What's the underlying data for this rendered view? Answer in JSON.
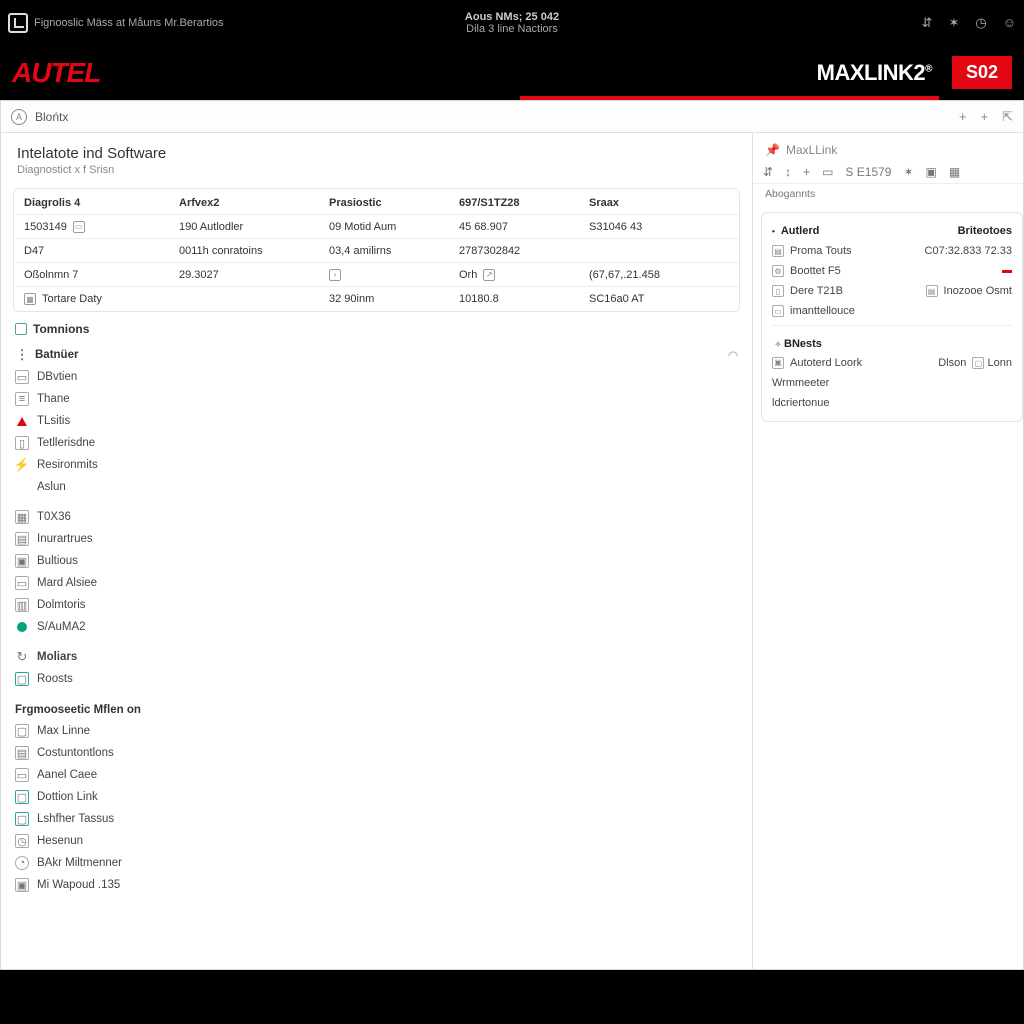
{
  "titlebar": {
    "title_left": "Fignooslic Mäss at Måuns Mr.Berartios",
    "center_line1": "Aous NMs; 25 042",
    "center_line2": "Dila 3 line Nactiors"
  },
  "brand": {
    "autel": "AUTEL",
    "maxlink": "MAXLINK2",
    "reg": "®",
    "badge": "S02"
  },
  "toolbar": {
    "breadcrumb": "Blońtx"
  },
  "page": {
    "title": "Intelatote ind Software",
    "subtitle": "Diagnostict x f Srisn"
  },
  "grid": {
    "headers": [
      "Diagrolis 4",
      "Arfvex2",
      "Prasiostic",
      "697/S1TZ28",
      "Sraax"
    ],
    "rows": [
      [
        "1503149",
        "190 Autlodler",
        "09 Motid Aum",
        "45 68.907",
        "S31046 43"
      ],
      [
        "D47",
        "0011h conratoins",
        "03,4 amilirns",
        "2787302842",
        ""
      ],
      [
        "Oßolnmn 7",
        "29.3027",
        "",
        "Orh",
        "(67,67,.21.458"
      ],
      [
        "Tortare Daty",
        "",
        "32 90inm",
        "10180.8",
        "SC16a0 AT"
      ]
    ]
  },
  "sections": {
    "tomnions": "Tomnions"
  },
  "nav_group1": {
    "head": "Batnüer",
    "items": [
      "DBvtien",
      "Thane",
      "TLsitis",
      "Tetllerisdne",
      "Resironmits",
      "Aslun"
    ]
  },
  "nav_group2": {
    "items": [
      "T0X36",
      "Inurartrues",
      "Bultious",
      "Mard Alsiee",
      "Dolmtoris",
      "S/AuMA2"
    ]
  },
  "nav_group3": {
    "items": [
      "Moliars",
      "Roosts"
    ]
  },
  "nav_group4": {
    "head": "Frgmooseetic Mflen on",
    "items": [
      "Max Linne",
      "Costuntontlons",
      "Aanel Caee",
      "Dottion Link",
      "Lshfher Tassus",
      "Hesenun",
      "BAkr Miltmenner",
      "Mi Wapoud .135"
    ]
  },
  "side": {
    "title": "MaxLLink",
    "toolbar_label": "Abogannts",
    "toolbar_code": "S E1579",
    "box": {
      "head_left": "Autlerd",
      "head_right": "Briteotoes",
      "r1_l": "Proma Touts",
      "r1_r": "C07:32.833 72.33",
      "r2_l": "Boottet F5",
      "r3_l": "Dere T21B",
      "r3_r": "Inozooe Osmt",
      "r4_l": "imanttellouce",
      "sec2": "BNests",
      "r5_l": "Autoterd Loork",
      "r5_r1": "Dlson",
      "r5_r2": "Lonn",
      "r6_l": "Wrmmeeter",
      "r7_l": "ldcriertonue"
    }
  }
}
